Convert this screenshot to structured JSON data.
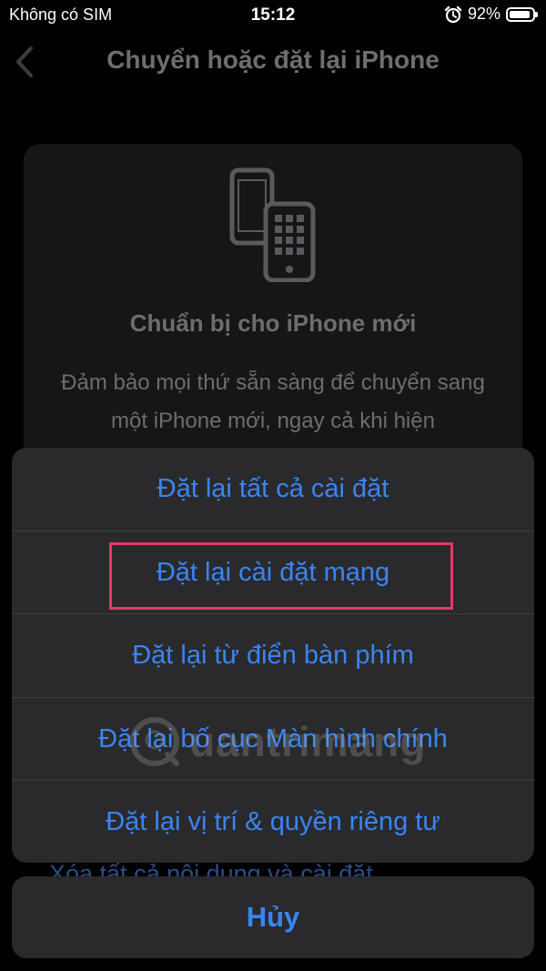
{
  "status_bar": {
    "carrier": "Không có SIM",
    "time": "15:12",
    "battery_percent": "92%",
    "battery_level": 0.92
  },
  "nav": {
    "title": "Chuyển hoặc đặt lại iPhone"
  },
  "card": {
    "title": "Chuẩn bị cho iPhone mới",
    "body": "Đảm bảo mọi thứ sẵn sàng để chuyển sang một iPhone mới, ngay cả khi hiện"
  },
  "behind_link": "Xóa tất cả nội dung và cài đặt",
  "action_sheet": {
    "options": [
      {
        "label": "Đặt lại tất cả cài đặt"
      },
      {
        "label": "Đặt lại cài đặt mạng"
      },
      {
        "label": "Đặt lại từ điển bàn phím"
      },
      {
        "label": "Đặt lại bố cục Màn hình chính"
      },
      {
        "label": "Đặt lại vị trí & quyền riêng tư"
      }
    ],
    "cancel_label": "Hủy"
  },
  "watermark": "uantrimang",
  "colors": {
    "accent": "#3a85f5",
    "highlight": "#e23a63",
    "sheet_bg": "#2a2a2c"
  }
}
